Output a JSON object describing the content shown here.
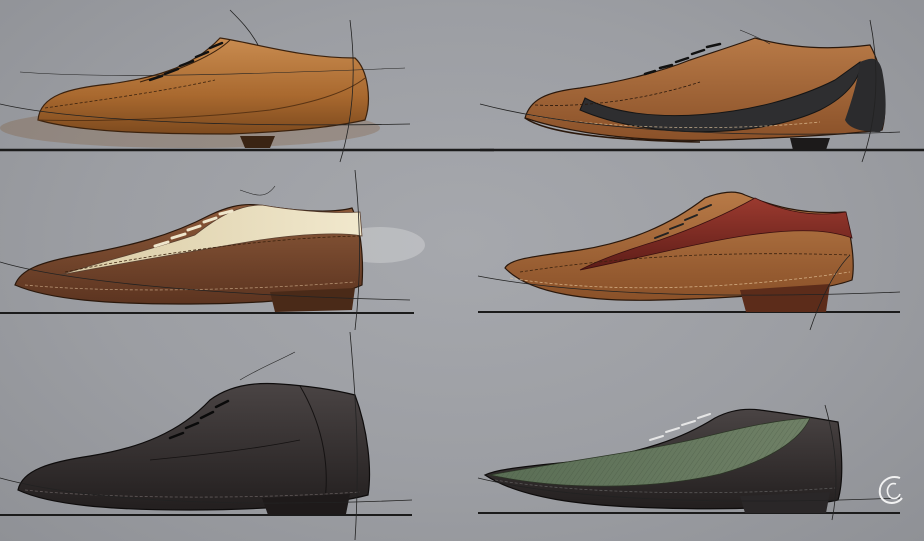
{
  "sheet": {
    "background": "#9c9ea3",
    "shoes": [
      {
        "id": "shoe-tan-oxford",
        "colors": {
          "upper": "#b3753c",
          "shade": "#7d4a1e",
          "sole": "#5a3414"
        }
      },
      {
        "id": "shoe-brown-black-swoosh",
        "colors": {
          "upper": "#a8693a",
          "accent": "#2e2e30",
          "sole": "#3a2415"
        }
      },
      {
        "id": "shoe-brown-cream-panel",
        "colors": {
          "upper": "#7a4a2e",
          "accent": "#e9dfc0",
          "sole": "#4a2a18"
        }
      },
      {
        "id": "shoe-tan-burgundy",
        "colors": {
          "upper": "#b8793e",
          "accent": "#7e2a22",
          "sole": "#5c2c1a"
        }
      },
      {
        "id": "shoe-dark-chukka",
        "colors": {
          "upper": "#3b3535",
          "shade": "#262222",
          "sole": "#1e1a1a"
        }
      },
      {
        "id": "shoe-green-grey-dress",
        "colors": {
          "upper": "#454243",
          "accent": "#5f6f55",
          "sole": "#2a2728"
        }
      }
    ]
  },
  "signature": {
    "icon": "artist-monogram-icon"
  }
}
